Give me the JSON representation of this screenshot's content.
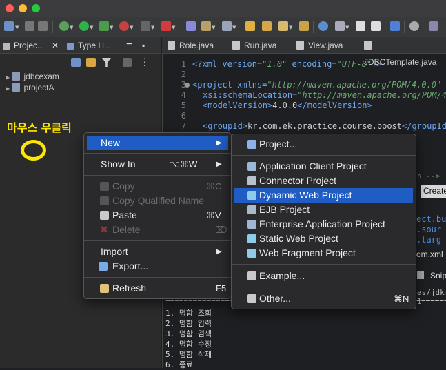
{
  "annotation": {
    "label": "마우스 우클릭"
  },
  "left_panel": {
    "tabs": [
      "Projec...",
      "Type H..."
    ],
    "tree": [
      "jdbcexam",
      "projectA"
    ]
  },
  "editor": {
    "tabs": [
      "Role.java",
      "Run.java",
      "View.java",
      "JDBCTemplate.java"
    ],
    "line_numbers": [
      "1",
      "2",
      "3",
      "4",
      "5",
      "6",
      "7"
    ],
    "code": {
      "l1": {
        "a": "<?xml version=",
        "b": "\"1.0\"",
        "c": " encoding=",
        "d": "\"UTF-8\"",
        "e": "?>"
      },
      "l3": {
        "a": "<project xmlns=",
        "b": "\"http://maven.apache.org/POM/4.0.0\""
      },
      "l4": {
        "a": "xsi:schemaLocation=",
        "b": "\"http://maven.apache.org/POM/4"
      },
      "l5": {
        "a": "<modelVersion>",
        "b": "4.0.0",
        "c": "</modelVersion>"
      },
      "l7": {
        "a": "<groupId>",
        "b": "kr.com.ek.practice.course.boost",
        "c": "</groupId"
      }
    },
    "partials": {
      "comment": "n -->",
      "create": "Create",
      "p1": "ect.bu",
      "p2": ".sour",
      "p3": ".targ",
      "pom": "om.xml",
      "snip": "Snip",
      "jdk": "es/jdk-1"
    }
  },
  "console": {
    "rule": "======================================================================",
    "lines": [
      "1. 명함 조회",
      "2. 명함 입력",
      "3. 명함 검색",
      "4. 명함 수정",
      "5. 명함 삭제",
      "6. 종료"
    ]
  },
  "context_menu": {
    "items": [
      {
        "label": "New",
        "state": "selected",
        "arrow": true
      },
      {
        "label": "Show In",
        "shortcut": "⌥⌘W",
        "arrow": true
      },
      {
        "label": "Copy",
        "shortcut": "⌘C",
        "state": "disabled"
      },
      {
        "label": "Copy Qualified Name",
        "state": "disabled"
      },
      {
        "label": "Paste",
        "shortcut": "⌘V"
      },
      {
        "label": "Delete",
        "shortcut": "⌦",
        "state": "disabled"
      },
      {
        "label": "Import",
        "arrow": true
      },
      {
        "label": "Export..."
      },
      {
        "label": "Refresh",
        "shortcut": "F5"
      }
    ]
  },
  "submenu": {
    "items": [
      {
        "label": "Project..."
      },
      {
        "label": "Application Client Project"
      },
      {
        "label": "Connector Project"
      },
      {
        "label": "Dynamic Web Project",
        "state": "selected"
      },
      {
        "label": "EJB Project"
      },
      {
        "label": "Enterprise Application Project"
      },
      {
        "label": "Static Web Project"
      },
      {
        "label": "Web Fragment Project"
      },
      {
        "label": "Example..."
      },
      {
        "label": "Other...",
        "shortcut": "⌘N"
      }
    ]
  },
  "colors": {
    "accent": "#1f5dc4",
    "annotation": "#ffe600"
  }
}
